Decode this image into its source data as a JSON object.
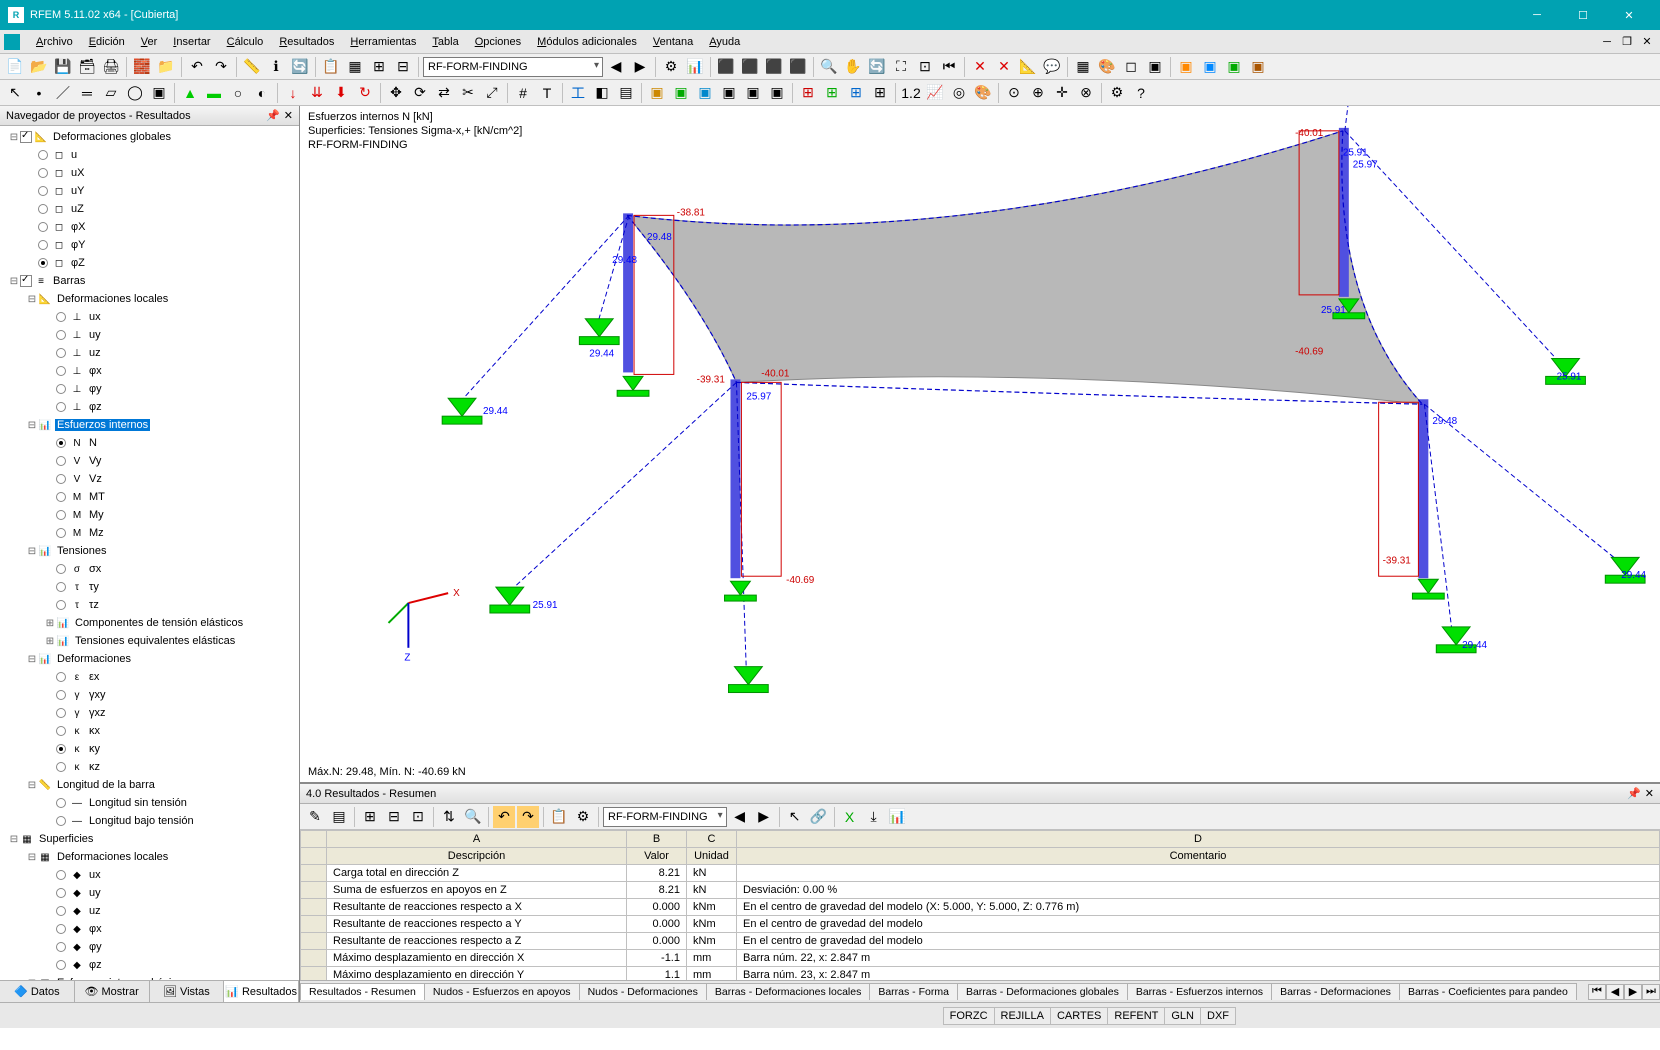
{
  "window": {
    "title": "RFEM 5.11.02 x64 - [Cubierta]"
  },
  "menu": [
    "Archivo",
    "Edición",
    "Ver",
    "Insertar",
    "Cálculo",
    "Resultados",
    "Herramientas",
    "Tabla",
    "Opciones",
    "Módulos adicionales",
    "Ventana",
    "Ayuda"
  ],
  "toolbar_combo": "RF-FORM-FINDING",
  "nav": {
    "title": "Navegador de proyectos - Resultados",
    "tabs": [
      "Datos",
      "Mostrar",
      "Vistas",
      "Resultados"
    ],
    "active_tab": 3,
    "tree": [
      {
        "d": 0,
        "tg": "⊟",
        "ck": true,
        "ic": "📐",
        "lbl": "Deformaciones globales"
      },
      {
        "d": 1,
        "rd": false,
        "ic": "◻",
        "lbl": "u"
      },
      {
        "d": 1,
        "rd": false,
        "ic": "◻",
        "lbl": "uX"
      },
      {
        "d": 1,
        "rd": false,
        "ic": "◻",
        "lbl": "uY"
      },
      {
        "d": 1,
        "rd": false,
        "ic": "◻",
        "lbl": "uZ"
      },
      {
        "d": 1,
        "rd": false,
        "ic": "◻",
        "lbl": "φX"
      },
      {
        "d": 1,
        "rd": false,
        "ic": "◻",
        "lbl": "φY"
      },
      {
        "d": 1,
        "rd": true,
        "ic": "◻",
        "lbl": "φZ"
      },
      {
        "d": 0,
        "tg": "⊟",
        "ck": true,
        "ic": "≡",
        "lbl": "Barras"
      },
      {
        "d": 1,
        "tg": "⊟",
        "ic": "📐",
        "lbl": "Deformaciones locales"
      },
      {
        "d": 2,
        "rd": false,
        "ic": "⊥",
        "lbl": "ux"
      },
      {
        "d": 2,
        "rd": false,
        "ic": "⊥",
        "lbl": "uy"
      },
      {
        "d": 2,
        "rd": false,
        "ic": "⊥",
        "lbl": "uz"
      },
      {
        "d": 2,
        "rd": false,
        "ic": "⊥",
        "lbl": "φx"
      },
      {
        "d": 2,
        "rd": false,
        "ic": "⊥",
        "lbl": "φy"
      },
      {
        "d": 2,
        "rd": false,
        "ic": "⊥",
        "lbl": "φz"
      },
      {
        "d": 1,
        "tg": "⊟",
        "ic": "📊",
        "lbl": "Esfuerzos internos",
        "sel": true
      },
      {
        "d": 2,
        "rd": true,
        "ic": "N",
        "lbl": "N"
      },
      {
        "d": 2,
        "rd": false,
        "ic": "V",
        "lbl": "Vy"
      },
      {
        "d": 2,
        "rd": false,
        "ic": "V",
        "lbl": "Vz"
      },
      {
        "d": 2,
        "rd": false,
        "ic": "M",
        "lbl": "MT"
      },
      {
        "d": 2,
        "rd": false,
        "ic": "M",
        "lbl": "My"
      },
      {
        "d": 2,
        "rd": false,
        "ic": "M",
        "lbl": "Mz"
      },
      {
        "d": 1,
        "tg": "⊟",
        "ic": "📊",
        "lbl": "Tensiones"
      },
      {
        "d": 2,
        "rd": false,
        "ic": "σ",
        "lbl": "σx"
      },
      {
        "d": 2,
        "rd": false,
        "ic": "τ",
        "lbl": "τy"
      },
      {
        "d": 2,
        "rd": false,
        "ic": "τ",
        "lbl": "τz"
      },
      {
        "d": 2,
        "tg": "⊞",
        "ic": "📊",
        "lbl": "Componentes de tensión elásticos"
      },
      {
        "d": 2,
        "tg": "⊞",
        "ic": "📊",
        "lbl": "Tensiones equivalentes elásticas"
      },
      {
        "d": 1,
        "tg": "⊟",
        "ic": "📊",
        "lbl": "Deformaciones"
      },
      {
        "d": 2,
        "rd": false,
        "ic": "ε",
        "lbl": "εx"
      },
      {
        "d": 2,
        "rd": false,
        "ic": "γ",
        "lbl": "γxy"
      },
      {
        "d": 2,
        "rd": false,
        "ic": "γ",
        "lbl": "γxz"
      },
      {
        "d": 2,
        "rd": false,
        "ic": "κ",
        "lbl": "κx"
      },
      {
        "d": 2,
        "rd": true,
        "ic": "κ",
        "lbl": "κy"
      },
      {
        "d": 2,
        "rd": false,
        "ic": "κ",
        "lbl": "κz"
      },
      {
        "d": 1,
        "tg": "⊟",
        "ic": "📏",
        "lbl": "Longitud de la barra"
      },
      {
        "d": 2,
        "rd": false,
        "ic": "—",
        "lbl": "Longitud sin tensión"
      },
      {
        "d": 2,
        "rd": false,
        "ic": "—",
        "lbl": "Longitud bajo tensión"
      },
      {
        "d": 0,
        "tg": "⊟",
        "ic": "▦",
        "lbl": "Superficies"
      },
      {
        "d": 1,
        "tg": "⊟",
        "ic": "▦",
        "lbl": "Deformaciones locales"
      },
      {
        "d": 2,
        "rd": false,
        "ic": "◆",
        "lbl": "ux"
      },
      {
        "d": 2,
        "rd": false,
        "ic": "◆",
        "lbl": "uy"
      },
      {
        "d": 2,
        "rd": false,
        "ic": "◆",
        "lbl": "uz"
      },
      {
        "d": 2,
        "rd": false,
        "ic": "◆",
        "lbl": "φx"
      },
      {
        "d": 2,
        "rd": false,
        "ic": "◆",
        "lbl": "φy"
      },
      {
        "d": 2,
        "rd": false,
        "ic": "◆",
        "lbl": "φz"
      },
      {
        "d": 1,
        "tg": "⊞",
        "ic": "▦",
        "lbl": "Esfuerzos internos básicos"
      }
    ]
  },
  "viewport": {
    "overlay": [
      "Esfuerzos internos N [kN]",
      "Superficies: Tensiones Sigma-x,+ [kN/cm^2]",
      "RF-FORM-FINDING"
    ],
    "footer": "Máx.N: 29.48, Mín. N: -40.69 kN",
    "labels": {
      "blue": [
        "29.48",
        "29.48",
        "29.44",
        "29.44",
        "25.91",
        "25.97",
        "25.91",
        "25.91",
        "25.97",
        "29.48",
        "29.44",
        "25.91",
        "29.44"
      ],
      "red": [
        "-40.01",
        "-38.81",
        "-39.31",
        "-40.01",
        "-40.69",
        "-40.69",
        "-39.31"
      ]
    }
  },
  "results": {
    "title": "4.0 Resultados - Resumen",
    "combo": "RF-FORM-FINDING",
    "cols": [
      "",
      "Descripción",
      "Valor",
      "Unidad",
      "Comentario"
    ],
    "col_letters": [
      "",
      "A",
      "B",
      "C",
      "D"
    ],
    "rows": [
      [
        "Carga total en dirección Z",
        "8.21",
        "kN",
        ""
      ],
      [
        "Suma de esfuerzos en apoyos en Z",
        "8.21",
        "kN",
        "Desviación:   0.00 %"
      ],
      [
        "Resultante de reacciones respecto a X",
        "0.000",
        "kNm",
        "En el centro de gravedad del modelo (X: 5.000, Y: 5.000, Z: 0.776 m)"
      ],
      [
        "Resultante de reacciones respecto a Y",
        "0.000",
        "kNm",
        "En el centro de gravedad del modelo"
      ],
      [
        "Resultante de reacciones respecto a Z",
        "0.000",
        "kNm",
        "En el centro de gravedad del modelo"
      ],
      [
        "Máximo desplazamiento en dirección X",
        "-1.1",
        "mm",
        "Barra núm. 22, x: 2.847 m"
      ],
      [
        "Máximo desplazamiento en dirección Y",
        "1.1",
        "mm",
        "Barra núm. 23, x: 2.847 m"
      ]
    ],
    "tabs": [
      "Resultados - Resumen",
      "Nudos - Esfuerzos en apoyos",
      "Nudos - Deformaciones",
      "Barras - Deformaciones locales",
      "Barras - Forma",
      "Barras - Deformaciones globales",
      "Barras - Esfuerzos internos",
      "Barras - Deformaciones",
      "Barras - Coeficientes para pandeo"
    ]
  },
  "status": [
    "FORZC",
    "REJILLA",
    "CARTES",
    "REFENT",
    "GLN",
    "DXF"
  ]
}
